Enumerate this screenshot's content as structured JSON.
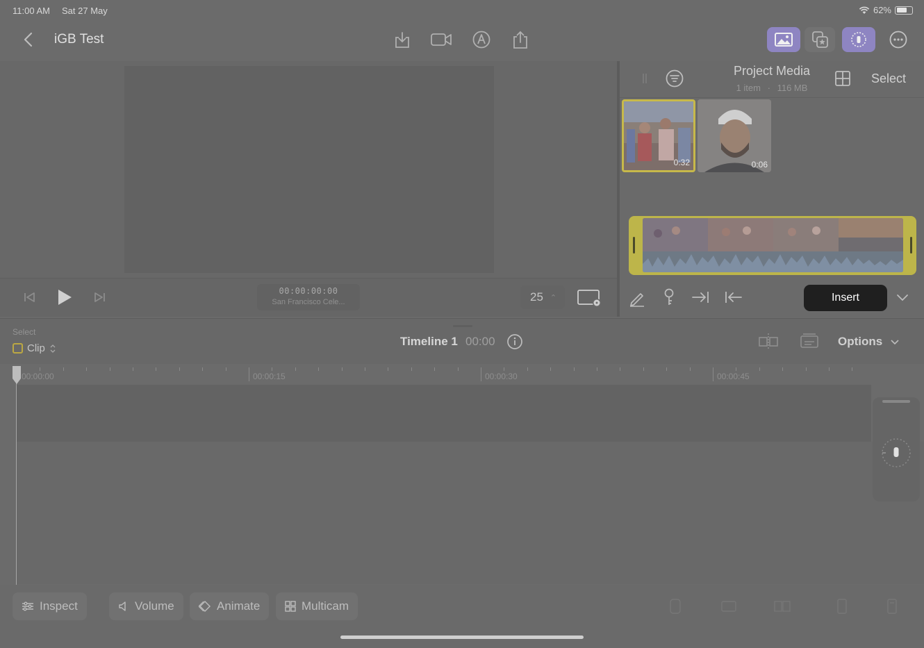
{
  "status_bar": {
    "time": "11:00 AM",
    "date": "Sat 27 May",
    "battery": "62%"
  },
  "nav": {
    "project_title": "iGB Test"
  },
  "viewer": {
    "timecode": "00:00:00:00",
    "clip_name": "San Francisco Cele...",
    "frame_rate": "25",
    "frame_rate_stepper": "⌃"
  },
  "browser": {
    "title": "Project Media",
    "item_count": "1 item",
    "separator": "·",
    "size": "116 MB",
    "select_label": "Select",
    "thumbnails": [
      {
        "duration": "0:32",
        "selected": true
      },
      {
        "duration": "0:06",
        "selected": false
      }
    ],
    "insert_label": "Insert"
  },
  "timeline": {
    "select_label": "Select",
    "mode_label": "Clip",
    "name": "Timeline 1",
    "timecode": "00:00",
    "options_label": "Options",
    "ruler_labels": [
      "00:00:00",
      "00:00:15",
      "00:00:30",
      "00:00:45"
    ]
  },
  "bottom_bar": {
    "inspect_label": "Inspect",
    "volume_label": "Volume",
    "animate_label": "Animate",
    "multicam_label": "Multicam"
  },
  "colors": {
    "accent_purple": "#8e85c2",
    "selection_yellow": "#c7b94a",
    "insert_bg": "#1f1f1f"
  }
}
